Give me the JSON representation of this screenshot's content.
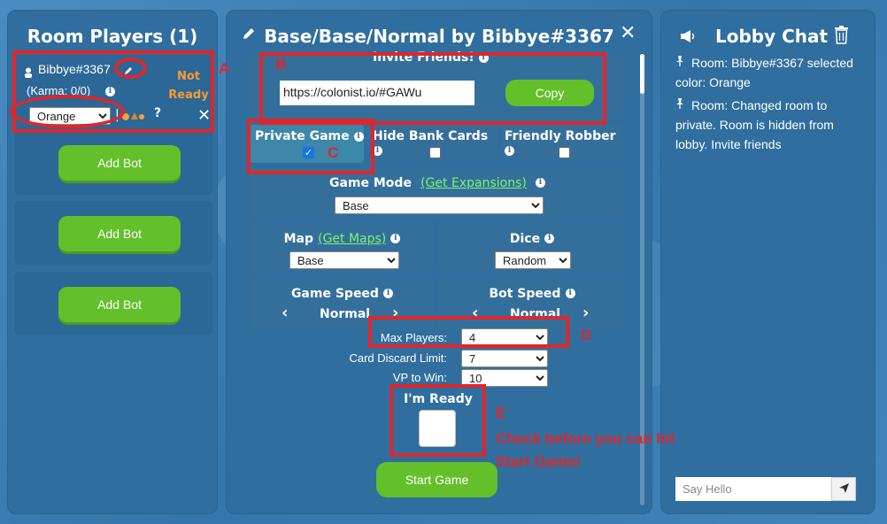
{
  "players": {
    "title": "Room Players (1)",
    "player": {
      "name": "Bibbye#3367",
      "karma": "(Karma: 0/0)",
      "status_line1": "Not",
      "status_line2": "Ready",
      "color_value": "Orange",
      "status_color": "#ff9a2e"
    },
    "bot_slots": [
      {
        "label": "Add Bot"
      },
      {
        "label": "Add Bot"
      },
      {
        "label": "Add Bot"
      }
    ]
  },
  "settings": {
    "title": "Base/Base/Normal by Bibbye#3367",
    "invite": {
      "label": "Invite Friends!",
      "url": "https://colonist.io/#GAWu",
      "copy_label": "Copy"
    },
    "toggles": [
      {
        "label": "Private Game",
        "checked": true
      },
      {
        "label": "Hide Bank Cards",
        "checked": false
      },
      {
        "label": "Friendly Robber",
        "checked": false
      }
    ],
    "game_mode": {
      "label": "Game Mode",
      "link": "(Get Expansions)",
      "value": "Base"
    },
    "map": {
      "label": "Map",
      "link": "(Get Maps)",
      "value": "Base"
    },
    "dice": {
      "label": "Dice",
      "value": "Random"
    },
    "game_speed": {
      "label": "Game Speed",
      "value": "Normal"
    },
    "bot_speed": {
      "label": "Bot Speed",
      "value": "Normal"
    },
    "max_players": {
      "label": "Max Players:",
      "value": "4"
    },
    "discard_limit": {
      "label": "Card Discard Limit:",
      "value": "7"
    },
    "vp_to_win": {
      "label": "VP to Win:",
      "value": "10"
    },
    "ready_label": "I'm Ready",
    "start_label": "Start Game"
  },
  "chat": {
    "title": "Lobby Chat",
    "messages": [
      {
        "text": "Room: Bibbye#3367 selected color: Orange"
      },
      {
        "text": "Room: Changed room to private. Room is hidden from lobby. Invite friends"
      }
    ],
    "input_placeholder": "Say Hello"
  },
  "annotations": {
    "a": "A",
    "b": "B",
    "c": "C",
    "d": "D",
    "e": "E",
    "note_line1": "Check before you can hit",
    "note_line2": "Start Game!",
    "color": "#e0262b"
  },
  "icons": {
    "edit": "pencil-icon",
    "close": "close-icon",
    "info": "info-icon",
    "person": "person-icon",
    "megaphone": "megaphone-icon",
    "trash": "trash-icon",
    "send": "send-icon"
  }
}
